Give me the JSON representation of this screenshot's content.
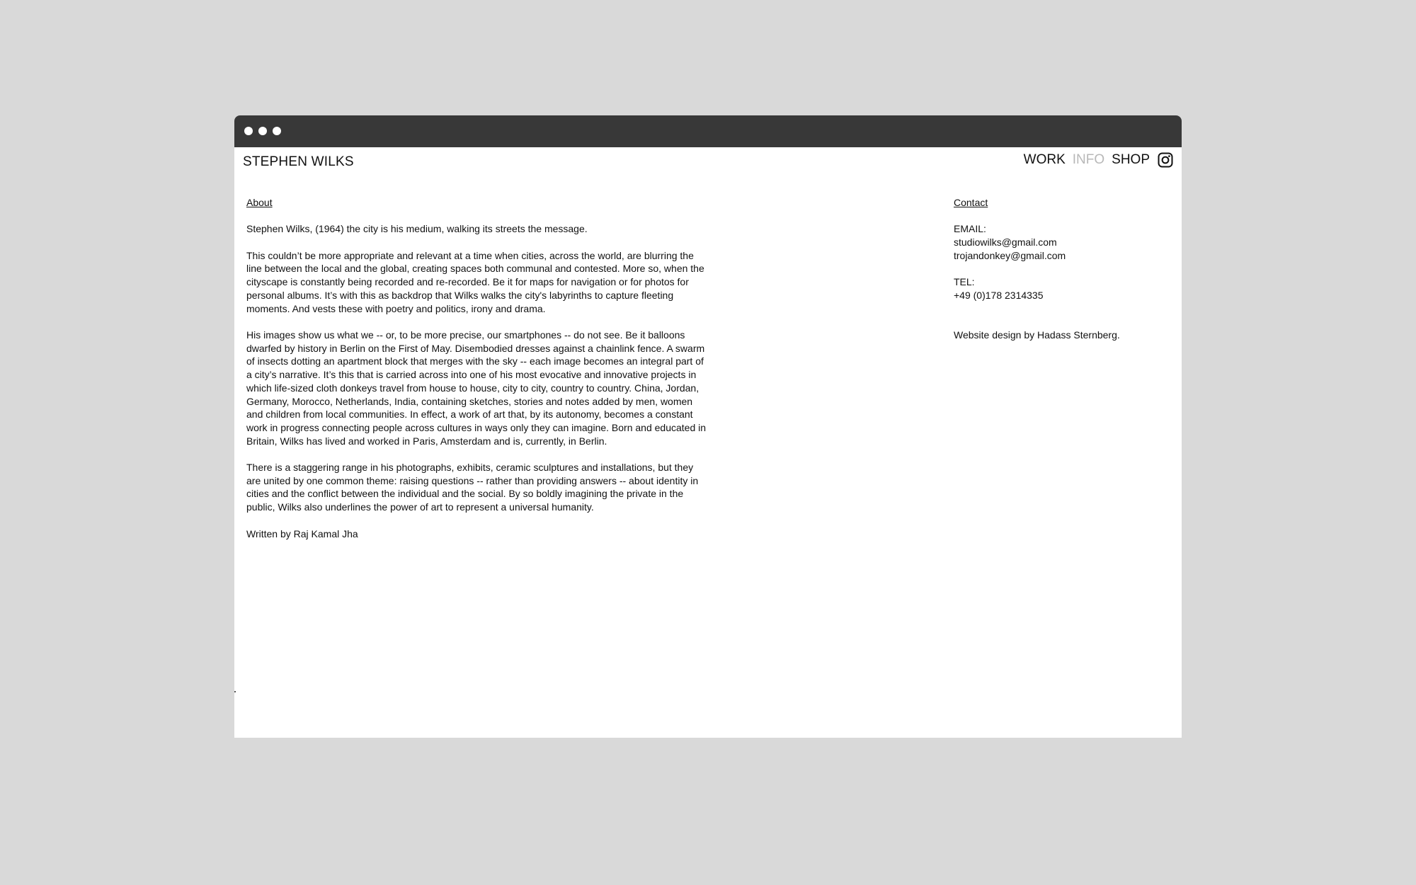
{
  "site": {
    "title": "STEPHEN WILKS"
  },
  "nav": {
    "items": [
      {
        "label": "WORK",
        "active": false
      },
      {
        "label": "INFO",
        "active": true
      },
      {
        "label": "SHOP",
        "active": false
      }
    ],
    "instagram_icon": "instagram-icon"
  },
  "about": {
    "heading": "About",
    "paragraphs": [
      "Stephen Wilks, (1964) the city is his medium, walking its streets the message.",
      "This couldn’t be more appropriate and relevant at a time when cities, across the world, are blurring the line between the local and the global, creating spaces both communal and contested. More so, when the cityscape is constantly being recorded and re-recorded. Be it for maps for navigation or for photos for personal albums. It’s with this as backdrop that Wilks walks the city's labyrinths to capture fleeting moments. And vests these with poetry and politics, irony and drama.",
      "His images show us what we -- or, to be more precise, our smartphones -- do not see. Be it balloons dwarfed by history in Berlin on the First of May. Disembodied dresses against a chainlink fence. A swarm of insects dotting an apartment block that merges with the sky -- each image becomes an integral part of a city’s narrative. It’s this that is carried across into one of his most evocative and innovative projects in which life-sized cloth donkeys travel from house to house, city to city, country to country. China, Jordan, Germany, Morocco, Netherlands, India, containing sketches, stories and notes added by men, women and children from local communities. In effect, a work of art that, by its autonomy, becomes a constant work in progress connecting people across cultures in ways only they can imagine. Born and educated in Britain, Wilks has lived and worked in Paris, Amsterdam and is, currently, in Berlin.",
      "There is a staggering range in his photographs, exhibits, ceramic sculptures and installations, but they are united by one common theme: raising questions -- rather than providing answers -- about identity in cities and the conflict between the individual and the social. By so boldly imagining the private in the public, Wilks also underlines the power of art to represent a universal humanity.",
      "Written by Raj Kamal Jha"
    ]
  },
  "contact": {
    "heading": "Contact",
    "email_label": "EMAIL:",
    "emails": [
      "studiowilks@gmail.com",
      "trojandonkey@gmail.com"
    ],
    "tel_label": "TEL:",
    "tel": "+49 (0)178 2314335",
    "credit_prefix": "Website design by ",
    "credit_name": "Hadass Sternberg."
  }
}
